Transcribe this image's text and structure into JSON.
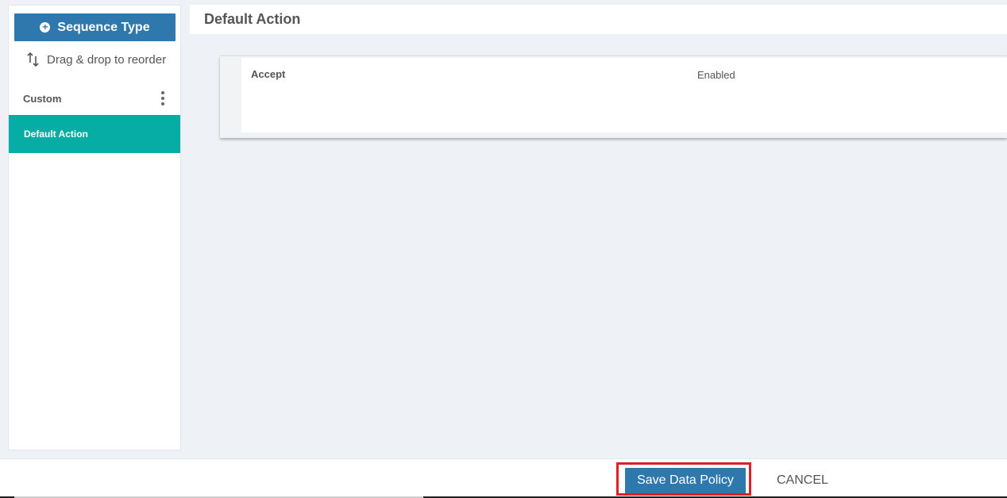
{
  "sidebar": {
    "sequence_button_label": "Sequence Type",
    "plus_icon": "plus-circle-icon",
    "drag_hint": "Drag & drop to reorder",
    "reorder_icon": "sort-arrows-icon",
    "group_label": "Custom",
    "group_menu_icon": "kebab-menu-icon",
    "active_item_label": "Default Action"
  },
  "main": {
    "title": "Default Action",
    "card": {
      "label": "Accept",
      "value": "Enabled"
    }
  },
  "footer": {
    "save_label": "Save Data Policy",
    "cancel_label": "CANCEL"
  },
  "colors": {
    "primary": "#2f78ad",
    "active_teal": "#05ada4",
    "highlight_red": "#e01e2a",
    "background": "#eef1f5"
  }
}
